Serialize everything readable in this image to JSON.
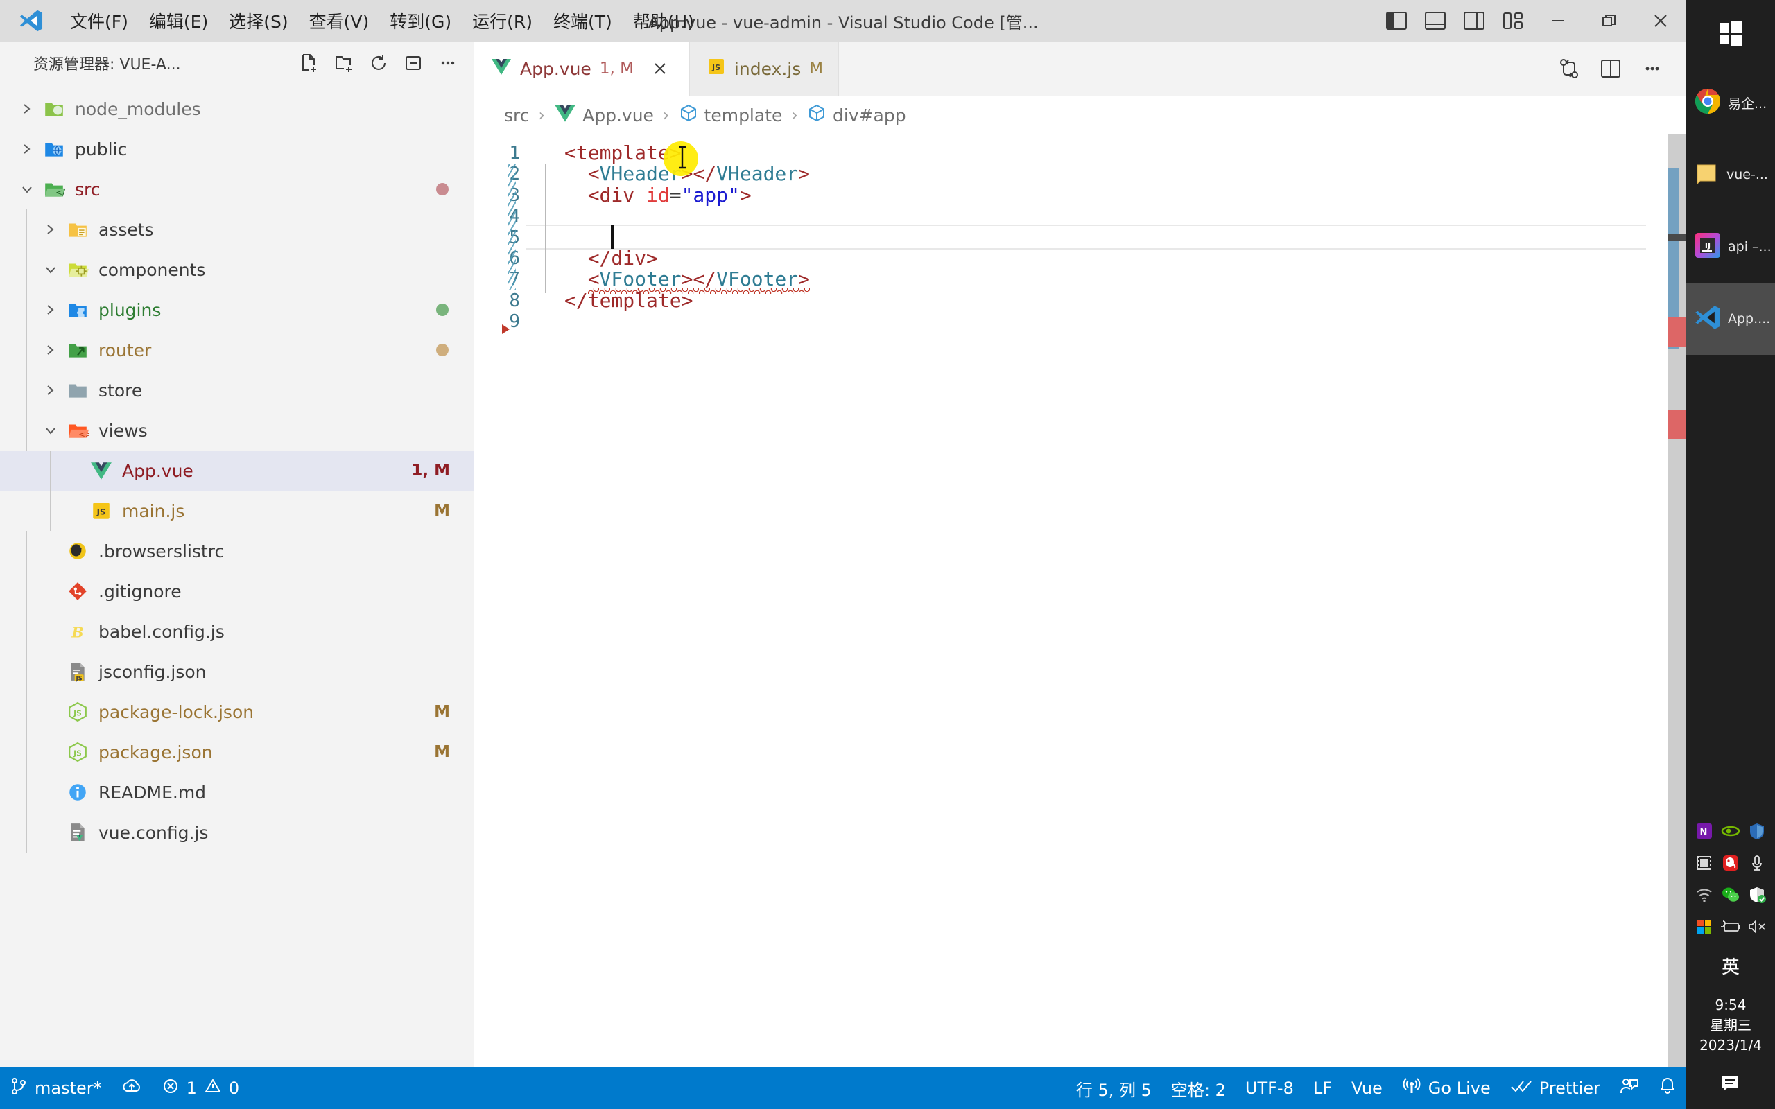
{
  "window": {
    "title": "App.vue - vue-admin - Visual Studio Code [管...",
    "menus": [
      "文件(F)",
      "编辑(E)",
      "选择(S)",
      "查看(V)",
      "转到(G)",
      "运行(R)",
      "终端(T)",
      "帮助(H)"
    ],
    "layout_buttons": [
      "toggle-primary-sidebar",
      "toggle-panel",
      "toggle-secondary-sidebar",
      "customize-layout"
    ],
    "controls": [
      "minimize",
      "restore",
      "close"
    ]
  },
  "sidebar": {
    "title": "资源管理器: VUE-A...",
    "actions": [
      "new-file",
      "new-folder",
      "refresh-explorer",
      "collapse-folders",
      "views-and-more-actions"
    ],
    "tree": [
      {
        "label": "node_modules",
        "type": "folder",
        "expanded": false,
        "depth": 0,
        "icon": "folder-node",
        "badge": "",
        "color": "#6f6f6f",
        "dot": ""
      },
      {
        "label": "public",
        "type": "folder",
        "expanded": false,
        "depth": 0,
        "icon": "folder-public",
        "badge": "",
        "color": "#3b3b3b",
        "dot": ""
      },
      {
        "label": "src",
        "type": "folder",
        "expanded": true,
        "depth": 0,
        "icon": "folder-src",
        "badge": "",
        "color": "#8f1d24",
        "dot": "#c98b90"
      },
      {
        "label": "assets",
        "type": "folder",
        "expanded": false,
        "depth": 1,
        "icon": "folder-assets",
        "badge": "",
        "color": "#3b3b3b",
        "dot": ""
      },
      {
        "label": "components",
        "type": "folder",
        "expanded": true,
        "depth": 1,
        "icon": "folder-components",
        "badge": "",
        "color": "#3b3b3b",
        "dot": ""
      },
      {
        "label": "plugins",
        "type": "folder",
        "expanded": false,
        "depth": 1,
        "icon": "folder-plugins",
        "badge": "",
        "color": "#2e7d32",
        "dot": "#79b47c"
      },
      {
        "label": "router",
        "type": "folder",
        "expanded": false,
        "depth": 1,
        "icon": "folder-router",
        "badge": "",
        "color": "#9a7433",
        "dot": "#cfae7d"
      },
      {
        "label": "store",
        "type": "folder",
        "expanded": false,
        "depth": 1,
        "icon": "folder-plain",
        "badge": "",
        "color": "#3b3b3b",
        "dot": ""
      },
      {
        "label": "views",
        "type": "folder",
        "expanded": true,
        "depth": 1,
        "icon": "folder-views",
        "badge": "",
        "color": "#3b3b3b",
        "dot": ""
      },
      {
        "label": "App.vue",
        "type": "file",
        "selected": true,
        "depth": 2,
        "icon": "vue-icon",
        "badge": "1, M",
        "color": "#8f1d24",
        "badge_color": "#8f1d24",
        "dot": ""
      },
      {
        "label": "main.js",
        "type": "file",
        "depth": 2,
        "icon": "js-icon",
        "badge": "M",
        "color": "#9a7433",
        "badge_color": "#9a7433",
        "dot": ""
      },
      {
        "label": ".browserslistrc",
        "type": "file",
        "depth": 1,
        "icon": "browserslist-icon",
        "badge": "",
        "color": "#3b3b3b",
        "dot": ""
      },
      {
        "label": ".gitignore",
        "type": "file",
        "depth": 1,
        "icon": "git-icon",
        "badge": "",
        "color": "#3b3b3b",
        "dot": ""
      },
      {
        "label": "babel.config.js",
        "type": "file",
        "depth": 1,
        "icon": "babel-icon",
        "badge": "",
        "color": "#3b3b3b",
        "dot": ""
      },
      {
        "label": "jsconfig.json",
        "type": "file",
        "depth": 1,
        "icon": "jsconfig-icon",
        "badge": "",
        "color": "#3b3b3b",
        "dot": ""
      },
      {
        "label": "package-lock.json",
        "type": "file",
        "depth": 1,
        "icon": "npm-icon",
        "badge": "M",
        "color": "#9a7433",
        "badge_color": "#9a7433",
        "dot": ""
      },
      {
        "label": "package.json",
        "type": "file",
        "depth": 1,
        "icon": "npm-icon",
        "badge": "M",
        "color": "#9a7433",
        "badge_color": "#9a7433",
        "dot": ""
      },
      {
        "label": "README.md",
        "type": "file",
        "depth": 1,
        "icon": "info-icon",
        "badge": "",
        "color": "#3b3b3b",
        "dot": ""
      },
      {
        "label": "vue.config.js",
        "type": "file",
        "depth": 1,
        "icon": "vue-config-icon",
        "badge": "",
        "color": "#3b3b3b",
        "dot": ""
      }
    ]
  },
  "editor": {
    "tabs": [
      {
        "name": "App.vue",
        "badge": "1, M",
        "icon": "vue-icon",
        "active": true,
        "closable": true
      },
      {
        "name": "index.js",
        "badge": "M",
        "icon": "js-icon",
        "active": false,
        "closable": false
      }
    ],
    "tab_actions": [
      "source-control-compare-icon",
      "split-editor-icon",
      "more-actions-icon"
    ],
    "breadcrumb": [
      {
        "label": "src",
        "icon": ""
      },
      {
        "label": "App.vue",
        "icon": "vue-icon"
      },
      {
        "label": "template",
        "icon": "symbol-field-icon"
      },
      {
        "label": "div#app",
        "icon": "symbol-field-icon"
      }
    ],
    "breadcrumb_separator": "›",
    "lines": [
      {
        "n": "1",
        "indent": 0,
        "tokens": [
          {
            "t": "<template>",
            "c": "tag"
          }
        ]
      },
      {
        "n": "2",
        "indent": 1,
        "tokens": [
          {
            "t": "<",
            "c": "tag"
          },
          {
            "t": "VHeader",
            "c": "comp"
          },
          {
            "t": ">",
            "c": "tag"
          },
          {
            "t": "</",
            "c": "tag"
          },
          {
            "t": "VHeader",
            "c": "comp"
          },
          {
            "t": ">",
            "c": "tag"
          }
        ]
      },
      {
        "n": "3",
        "indent": 1,
        "tokens": [
          {
            "t": "<div ",
            "c": "tag"
          },
          {
            "t": "id",
            "c": "attr"
          },
          {
            "t": "=",
            "c": "eq"
          },
          {
            "t": "\"app\"",
            "c": "str"
          },
          {
            "t": ">",
            "c": "tag"
          }
        ]
      },
      {
        "n": "4",
        "indent": 2,
        "tokens": []
      },
      {
        "n": "5",
        "indent": 2,
        "tokens": [],
        "cursor": true
      },
      {
        "n": "6",
        "indent": 1,
        "tokens": [
          {
            "t": "</div>",
            "c": "tag"
          }
        ]
      },
      {
        "n": "7",
        "indent": 1,
        "tokens": [
          {
            "t": "<",
            "c": "tag"
          },
          {
            "t": "VFooter",
            "c": "comp"
          },
          {
            "t": ">",
            "c": "tag"
          },
          {
            "t": "</",
            "c": "tag"
          },
          {
            "t": "VFooter",
            "c": "comp"
          },
          {
            "t": ">",
            "c": "tag"
          }
        ],
        "error": true
      },
      {
        "n": "8",
        "indent": 0,
        "tokens": [
          {
            "t": "</template>",
            "c": "tag"
          }
        ]
      },
      {
        "n": "9",
        "indent": 0,
        "tokens": []
      }
    ]
  },
  "statusbar": {
    "left": [
      {
        "icon": "source-control-branch-icon",
        "label": "master*"
      },
      {
        "icon": "sync-cloud-upload-icon",
        "label": ""
      },
      {
        "icon": "error-icon",
        "label": "1",
        "icon2": "warning-icon",
        "label2": "0"
      }
    ],
    "right": [
      {
        "icon": "",
        "label": "行 5, 列 5"
      },
      {
        "icon": "",
        "label": "空格: 2"
      },
      {
        "icon": "",
        "label": "UTF-8"
      },
      {
        "icon": "",
        "label": "LF"
      },
      {
        "icon": "",
        "label": "Vue"
      },
      {
        "icon": "broadcast-icon",
        "label": "Go Live"
      },
      {
        "icon": "check-all-icon",
        "label": "Prettier"
      },
      {
        "icon": "feedback-icon",
        "label": ""
      },
      {
        "icon": "bell-icon",
        "label": ""
      }
    ]
  },
  "taskbar": {
    "start": "windows-start-icon",
    "apps": [
      {
        "label": "易企...",
        "icon": "chrome-icon",
        "active": false
      },
      {
        "label": "vue-...",
        "icon": "folder-icon",
        "active": false
      },
      {
        "label": "api –...",
        "icon": "intellij-icon",
        "active": false
      },
      {
        "label": "App....",
        "icon": "vscode-icon",
        "active": true
      }
    ],
    "tray": [
      "onenote-icon",
      "nvidia-icon",
      "lastpass-icon",
      "media-icon",
      "qq-icon",
      "microphone-icon",
      "network-icon",
      "wechat-icon",
      "defender-icon",
      "microsoft-icon",
      "battery-charging-icon",
      "volume-muted-icon"
    ],
    "ime": "英",
    "clock": {
      "time": "9:54",
      "weekday": "星期三",
      "date": "2023/1/4"
    },
    "notification": "notification-icon"
  },
  "colors": {
    "accent": "#007acc",
    "titlebar_bg": "#dddddd",
    "sidebar_bg": "#f3f3f3",
    "editor_bg": "#ffffff",
    "selection_bg": "#e4e6f1",
    "taskbar_bg": "#1f1f1f",
    "error": "#c0392b",
    "highlight": "#ffeb00"
  }
}
